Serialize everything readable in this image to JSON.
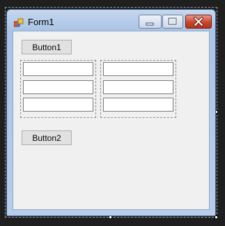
{
  "window": {
    "title": "Form1",
    "controls": {
      "minimize": "minimize-icon",
      "maximize": "maximize-icon",
      "close": "close-icon"
    }
  },
  "form": {
    "button1_label": "Button1",
    "button2_label": "Button2",
    "panels": [
      {
        "textboxes": [
          "",
          "",
          ""
        ]
      },
      {
        "textboxes": [
          "",
          "",
          ""
        ]
      }
    ]
  },
  "colors": {
    "close_button": "#c9462c",
    "client_background": "#f0f0f0",
    "designer_background": "#1f1f1f"
  }
}
